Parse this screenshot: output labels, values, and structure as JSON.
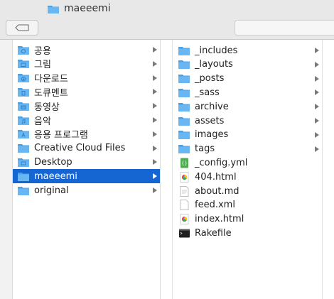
{
  "window": {
    "title": "maeeemi"
  },
  "colors": {
    "selection": "#1565d3",
    "folder": "#69b7f2",
    "folder_dark": "#4aa2e6"
  },
  "sidebar_column": {
    "items": [
      {
        "label": "공용",
        "icon": "public-folder-icon",
        "has_children": true
      },
      {
        "label": "그림",
        "icon": "pictures-folder-icon",
        "has_children": true
      },
      {
        "label": "다운로드",
        "icon": "downloads-folder-icon",
        "has_children": true
      },
      {
        "label": "도큐멘트",
        "icon": "documents-folder-icon",
        "has_children": true
      },
      {
        "label": "동영상",
        "icon": "movies-folder-icon",
        "has_children": true
      },
      {
        "label": "음악",
        "icon": "music-folder-icon",
        "has_children": true
      },
      {
        "label": "응용 프로그램",
        "icon": "applications-folder-icon",
        "has_children": true
      },
      {
        "label": "Creative Cloud Files",
        "icon": "folder-icon",
        "has_children": true
      },
      {
        "label": "Desktop",
        "icon": "desktop-folder-icon",
        "has_children": true
      },
      {
        "label": "maeeemi",
        "icon": "folder-icon",
        "has_children": true,
        "selected": true
      },
      {
        "label": "original",
        "icon": "folder-icon",
        "has_children": true
      }
    ]
  },
  "content_column": {
    "items": [
      {
        "label": "_includes",
        "icon": "folder-icon",
        "has_children": true
      },
      {
        "label": "_layouts",
        "icon": "folder-icon",
        "has_children": true
      },
      {
        "label": "_posts",
        "icon": "folder-icon",
        "has_children": true
      },
      {
        "label": "_sass",
        "icon": "folder-icon",
        "has_children": true
      },
      {
        "label": "archive",
        "icon": "folder-icon",
        "has_children": true
      },
      {
        "label": "assets",
        "icon": "folder-icon",
        "has_children": true
      },
      {
        "label": "images",
        "icon": "folder-icon",
        "has_children": true
      },
      {
        "label": "tags",
        "icon": "folder-icon",
        "has_children": true
      },
      {
        "label": "_config.yml",
        "icon": "yaml-file-icon",
        "has_children": false
      },
      {
        "label": "404.html",
        "icon": "html-file-icon",
        "has_children": false
      },
      {
        "label": "about.md",
        "icon": "markdown-file-icon",
        "has_children": false
      },
      {
        "label": "feed.xml",
        "icon": "xml-file-icon",
        "has_children": false
      },
      {
        "label": "index.html",
        "icon": "html-file-icon",
        "has_children": false
      },
      {
        "label": "Rakefile",
        "icon": "terminal-file-icon",
        "has_children": false
      }
    ]
  }
}
